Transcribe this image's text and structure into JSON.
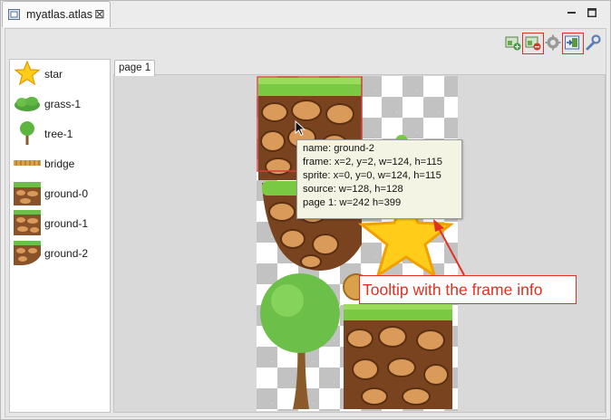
{
  "window": {
    "tab_title": "myatlas.atlas",
    "close_glyph": "⊠"
  },
  "toolbar": {
    "buttons": [
      "add-image-icon",
      "remove-image-icon",
      "gear-icon",
      "import-icon",
      "wrench-icon"
    ],
    "highlighted": [
      "remove-image-icon",
      "import-icon"
    ],
    "highlight_color": "#e03020"
  },
  "sprite_list": {
    "items": [
      {
        "label": "star",
        "icon": "star-icon"
      },
      {
        "label": "grass-1",
        "icon": "grass-icon"
      },
      {
        "label": "tree-1",
        "icon": "tree-icon"
      },
      {
        "label": "bridge",
        "icon": "bridge-icon"
      },
      {
        "label": "ground-0",
        "icon": "ground-icon"
      },
      {
        "label": "ground-1",
        "icon": "ground-icon"
      },
      {
        "label": "ground-2",
        "icon": "ground-icon"
      }
    ]
  },
  "page_tab": {
    "label": "page 1"
  },
  "tooltip": {
    "lines": [
      "name: ground-2",
      "frame: x=2, y=2, w=124, h=115",
      "sprite: x=0, y=0, w=124, h=115",
      "source: w=128, h=128",
      "page 1: w=242 h=399"
    ]
  },
  "annotation": {
    "text": "Tooltip with the frame info",
    "color": "#e03020"
  }
}
